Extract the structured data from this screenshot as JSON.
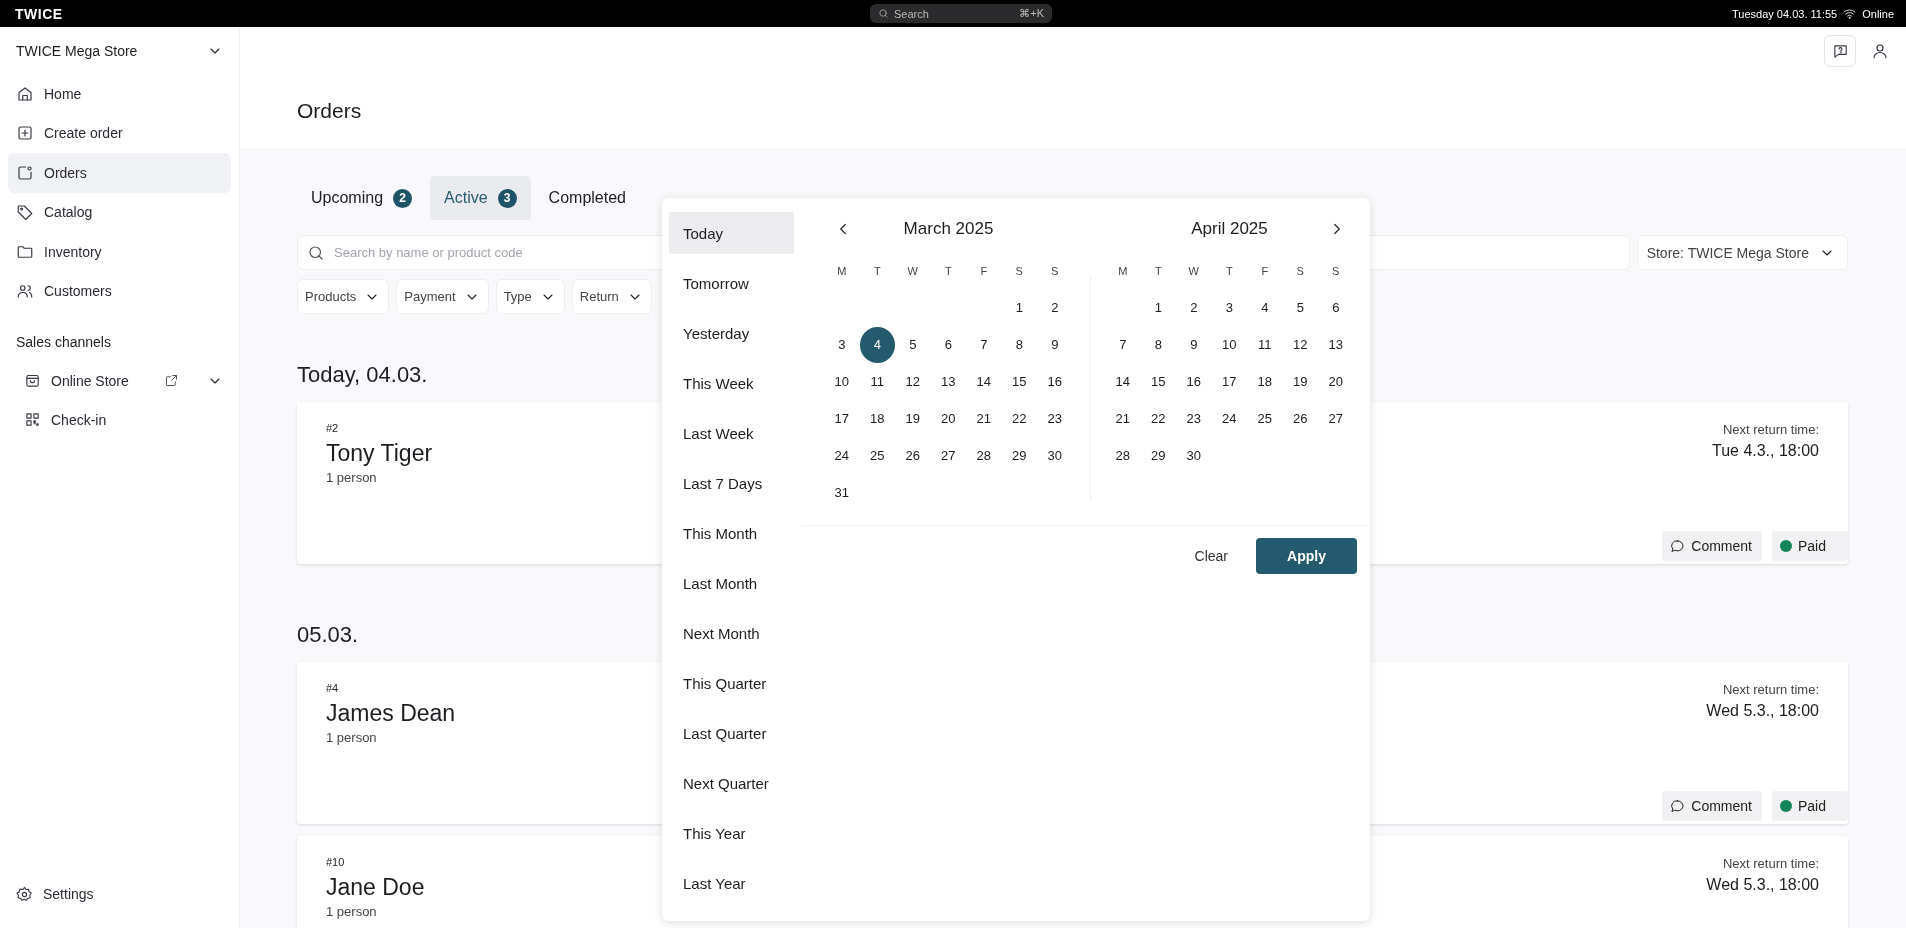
{
  "topbar": {
    "logo": "TWICE",
    "search": {
      "placeholder": "Search",
      "shortcut": "⌘+K"
    },
    "datetime": "Tuesday 04.03. 11:55",
    "status": "Online"
  },
  "sidebar": {
    "store": "TWICE Mega Store",
    "items": [
      {
        "label": "Home",
        "selected": false
      },
      {
        "label": "Create order",
        "selected": false
      },
      {
        "label": "Orders",
        "selected": true
      },
      {
        "label": "Catalog",
        "selected": false
      },
      {
        "label": "Inventory",
        "selected": false
      },
      {
        "label": "Customers",
        "selected": false
      }
    ],
    "section_title": "Sales channels",
    "channels": [
      {
        "label": "Online Store"
      },
      {
        "label": "Check-in"
      }
    ],
    "settings": "Settings"
  },
  "header": {
    "title": "Orders"
  },
  "tabs": [
    {
      "label": "Upcoming",
      "count": "2",
      "selected": false
    },
    {
      "label": "Active",
      "count": "3",
      "selected": true
    },
    {
      "label": "Completed",
      "selected": false
    }
  ],
  "search": {
    "placeholder": "Search by name or product code"
  },
  "store_filter": "Store: TWICE Mega Store",
  "filters": [
    "Products",
    "Payment",
    "Type",
    "Return"
  ],
  "groups": [
    {
      "title": "Today, 04.03.",
      "orders": [
        {
          "number": "#2",
          "name": "Tony Tiger",
          "people": "1 person",
          "return_label": "Next return time:",
          "return_time": "Tue 4.3., 18:00",
          "comment": "Comment",
          "payment": {
            "label": "Paid",
            "color": "#15845a"
          }
        }
      ]
    },
    {
      "title": "05.03.",
      "orders": [
        {
          "number": "#4",
          "name": "James Dean",
          "people": "1 person",
          "return_label": "Next return time:",
          "return_time": "Wed 5.3., 18:00",
          "comment": "Comment",
          "payment": {
            "label": "Paid",
            "color": "#15845a"
          }
        },
        {
          "number": "#10",
          "name": "Jane Doe",
          "people": "1 person",
          "return_label": "Next return time:",
          "return_time": "Wed 5.3., 18:00"
        }
      ]
    }
  ],
  "date_picker": {
    "presets": [
      {
        "label": "Today",
        "selected": true
      },
      {
        "label": "Tomorrow",
        "selected": false
      },
      {
        "label": "Yesterday",
        "selected": false
      },
      {
        "label": "This Week",
        "selected": false
      },
      {
        "label": "Last Week",
        "selected": false
      },
      {
        "label": "Last 7 Days",
        "selected": false
      },
      {
        "label": "This Month",
        "selected": false
      },
      {
        "label": "Last Month",
        "selected": false
      },
      {
        "label": "Next Month",
        "selected": false
      },
      {
        "label": "This Quarter",
        "selected": false
      },
      {
        "label": "Last Quarter",
        "selected": false
      },
      {
        "label": "Next Quarter",
        "selected": false
      },
      {
        "label": "This Year",
        "selected": false
      },
      {
        "label": "Last Year",
        "selected": false
      }
    ],
    "months": [
      {
        "title": "March 2025",
        "weekdays": [
          "M",
          "T",
          "W",
          "T",
          "F",
          "S",
          "S"
        ],
        "weeks": [
          [
            {
              "day": "1",
              "selected": false
            },
            {
              "day": "2",
              "selected": false
            }
          ],
          [
            {
              "day": "3",
              "selected": false
            },
            {
              "day": "4",
              "selected": true
            },
            {
              "day": "5",
              "selected": false
            },
            {
              "day": "6",
              "selected": false
            },
            {
              "day": "7",
              "selected": false
            },
            {
              "day": "8",
              "selected": false
            },
            {
              "day": "9",
              "selected": false
            }
          ],
          [
            {
              "day": "10",
              "selected": false
            },
            {
              "day": "11",
              "selected": false
            },
            {
              "day": "12",
              "selected": false
            },
            {
              "day": "13",
              "selected": false
            },
            {
              "day": "14",
              "selected": false
            },
            {
              "day": "15",
              "selected": false
            },
            {
              "day": "16",
              "selected": false
            }
          ],
          [
            {
              "day": "17",
              "selected": false
            },
            {
              "day": "18",
              "selected": false
            },
            {
              "day": "19",
              "selected": false
            },
            {
              "day": "20",
              "selected": false
            },
            {
              "day": "21",
              "selected": false
            },
            {
              "day": "22",
              "selected": false
            },
            {
              "day": "23",
              "selected": false
            }
          ],
          [
            {
              "day": "24",
              "selected": false
            },
            {
              "day": "25",
              "selected": false
            },
            {
              "day": "26",
              "selected": false
            },
            {
              "day": "27",
              "selected": false
            },
            {
              "day": "28",
              "selected": false
            },
            {
              "day": "29",
              "selected": false
            },
            {
              "day": "30",
              "selected": false
            }
          ],
          [
            {
              "day": "31",
              "selected": false
            }
          ]
        ]
      },
      {
        "title": "April 2025",
        "weekdays": [
          "M",
          "T",
          "W",
          "T",
          "F",
          "S",
          "S"
        ],
        "weeks": [
          [
            {
              "day": "1",
              "selected": false
            },
            {
              "day": "2",
              "selected": false
            },
            {
              "day": "3",
              "selected": false
            },
            {
              "day": "4",
              "selected": false
            },
            {
              "day": "5",
              "selected": false
            },
            {
              "day": "6",
              "selected": false
            }
          ],
          [
            {
              "day": "7",
              "selected": false
            },
            {
              "day": "8",
              "selected": false
            },
            {
              "day": "9",
              "selected": false
            },
            {
              "day": "10",
              "selected": false
            },
            {
              "day": "11",
              "selected": false
            },
            {
              "day": "12",
              "selected": false
            },
            {
              "day": "13",
              "selected": false
            }
          ],
          [
            {
              "day": "14",
              "selected": false
            },
            {
              "day": "15",
              "selected": false
            },
            {
              "day": "16",
              "selected": false
            },
            {
              "day": "17",
              "selected": false
            },
            {
              "day": "18",
              "selected": false
            },
            {
              "day": "19",
              "selected": false
            },
            {
              "day": "20",
              "selected": false
            }
          ],
          [
            {
              "day": "21",
              "selected": false
            },
            {
              "day": "22",
              "selected": false
            },
            {
              "day": "23",
              "selected": false
            },
            {
              "day": "24",
              "selected": false
            },
            {
              "day": "25",
              "selected": false
            },
            {
              "day": "26",
              "selected": false
            },
            {
              "day": "27",
              "selected": false
            }
          ],
          [
            {
              "day": "28",
              "selected": false
            },
            {
              "day": "29",
              "selected": false
            },
            {
              "day": "30",
              "selected": false
            }
          ]
        ]
      }
    ],
    "clear": "Clear",
    "apply": "Apply"
  }
}
